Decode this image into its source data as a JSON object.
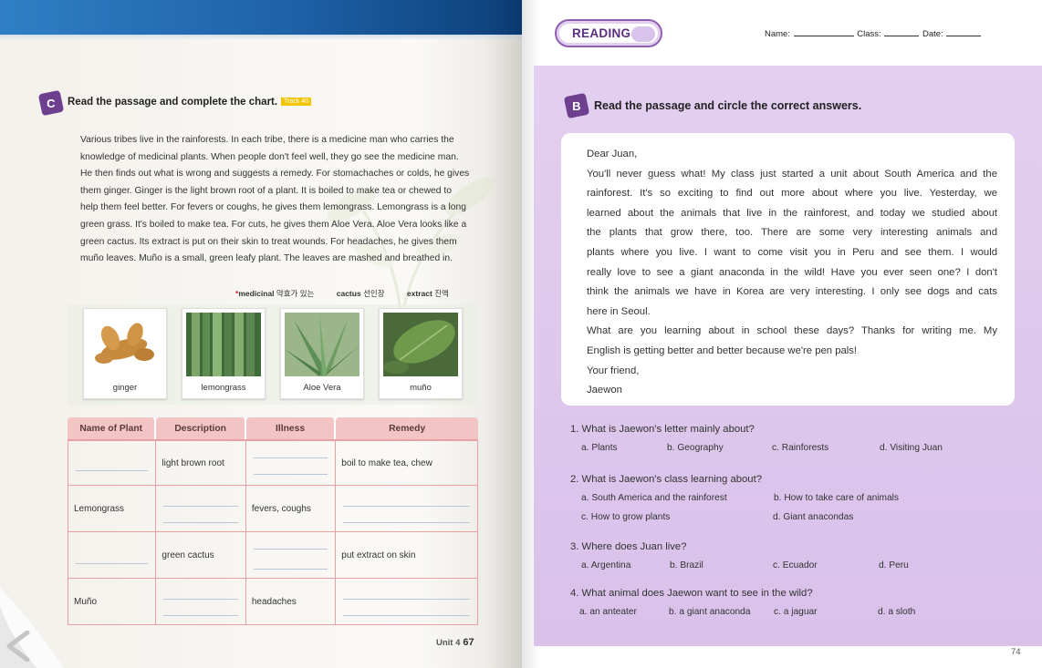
{
  "left_page": {
    "section_letter": "C",
    "instruction": "Read the passage and complete the chart.",
    "track_label": "Track 40",
    "passage_lines": [
      "Various tribes live in the rainforests. In each tribe, there is a medicine man who carries the",
      "knowledge of medicinal plants. When people don't feel well, they go see the medicine man.",
      "He then finds out what is wrong and suggests a remedy. For stomachaches or colds, he gives",
      "them ginger. Ginger is the light brown root of a plant. It is boiled to make tea or chewed to",
      "help them feel better. For fevers or coughs, he gives them lemongrass. Lemongrass is a long",
      "green grass. It's boiled to make tea. For cuts, he gives them Aloe Vera. Aloe Vera looks like a",
      "green cactus. Its extract is put on their skin to treat wounds. For headaches, he gives them",
      "muño leaves. Muño is a small, green leafy plant. The leaves are mashed and breathed in."
    ],
    "vocab": [
      {
        "marker": "*",
        "word": "medicinal",
        "gloss": "약효가 있는"
      },
      {
        "marker": "",
        "word": "cactus",
        "gloss": "선인장"
      },
      {
        "marker": "",
        "word": "extract",
        "gloss": "진액"
      }
    ],
    "photos": [
      {
        "caption": "ginger"
      },
      {
        "caption": "lemongrass"
      },
      {
        "caption": "Aloe Vera"
      },
      {
        "caption": "muño"
      }
    ],
    "chart": {
      "headers": [
        "Name of Plant",
        "Description",
        "Illness",
        "Remedy"
      ],
      "rows": [
        [
          "",
          "light brown root",
          "",
          "boil to make tea, chew"
        ],
        [
          "Lemongrass",
          "",
          "fevers, coughs",
          ""
        ],
        [
          "",
          "green cactus",
          "",
          "put extract on skin"
        ],
        [
          "Muño",
          "",
          "headaches",
          ""
        ]
      ]
    },
    "footer_unit": "Unit 4",
    "footer_page": "67"
  },
  "right_page": {
    "badge": "READING",
    "header": {
      "name_label": "Name:",
      "class_label": "Class:",
      "date_label": "Date:"
    },
    "section_letter": "B",
    "instruction": "Read the passage and circle the correct answers.",
    "letter_lines": [
      "Dear Juan,",
      "You'll never guess what! My class just started a unit about South America and the",
      "rainforest. It's so exciting to find out more about where you live. Yesterday, we",
      "learned about the animals that live in the rainforest, and today we studied about",
      "the plants that grow there, too. There are some very interesting animals and",
      "plants where you live. I want to come visit you in Peru and see them. I would",
      "really love to see a giant anaconda in the wild! Have you ever seen one? I don't",
      "think the animals we have in Korea are very interesting. I only see dogs and cats",
      "here in Seoul.",
      "What are you learning about in school these days? Thanks for writing me. My",
      "English is getting better and better because we're pen pals!",
      "Your friend,",
      "Jaewon"
    ],
    "questions": [
      {
        "text": "1. What is Jaewon's letter mainly about?",
        "options": [
          "a. Plants",
          "b. Geography",
          "c. Rainforests",
          "d. Visiting Juan"
        ]
      },
      {
        "text": "2. What is Jaewon's class learning about?",
        "options": [
          "a. South America and the rainforest",
          "b. How to take care of animals",
          "c. How to grow plants",
          "d. Giant anacondas"
        ]
      },
      {
        "text": "3. Where does Juan live?",
        "options": [
          "a. Argentina",
          "b. Brazil",
          "c. Ecuador",
          "d. Peru"
        ]
      },
      {
        "text": "4. What animal does Jaewon want to see in the wild?",
        "options": [
          "a. an anteater",
          "b. a giant anaconda",
          "c. a jaguar",
          "d. a sloth"
        ]
      }
    ],
    "page_number": "74"
  },
  "colors": {
    "accent_purple": "#6d3f8e",
    "panel_purple": "#e3cff0",
    "chart_header_pink": "#f3c4c4",
    "chart_border": "#e7a0a4",
    "top_band_blue": "#1e62a8"
  }
}
